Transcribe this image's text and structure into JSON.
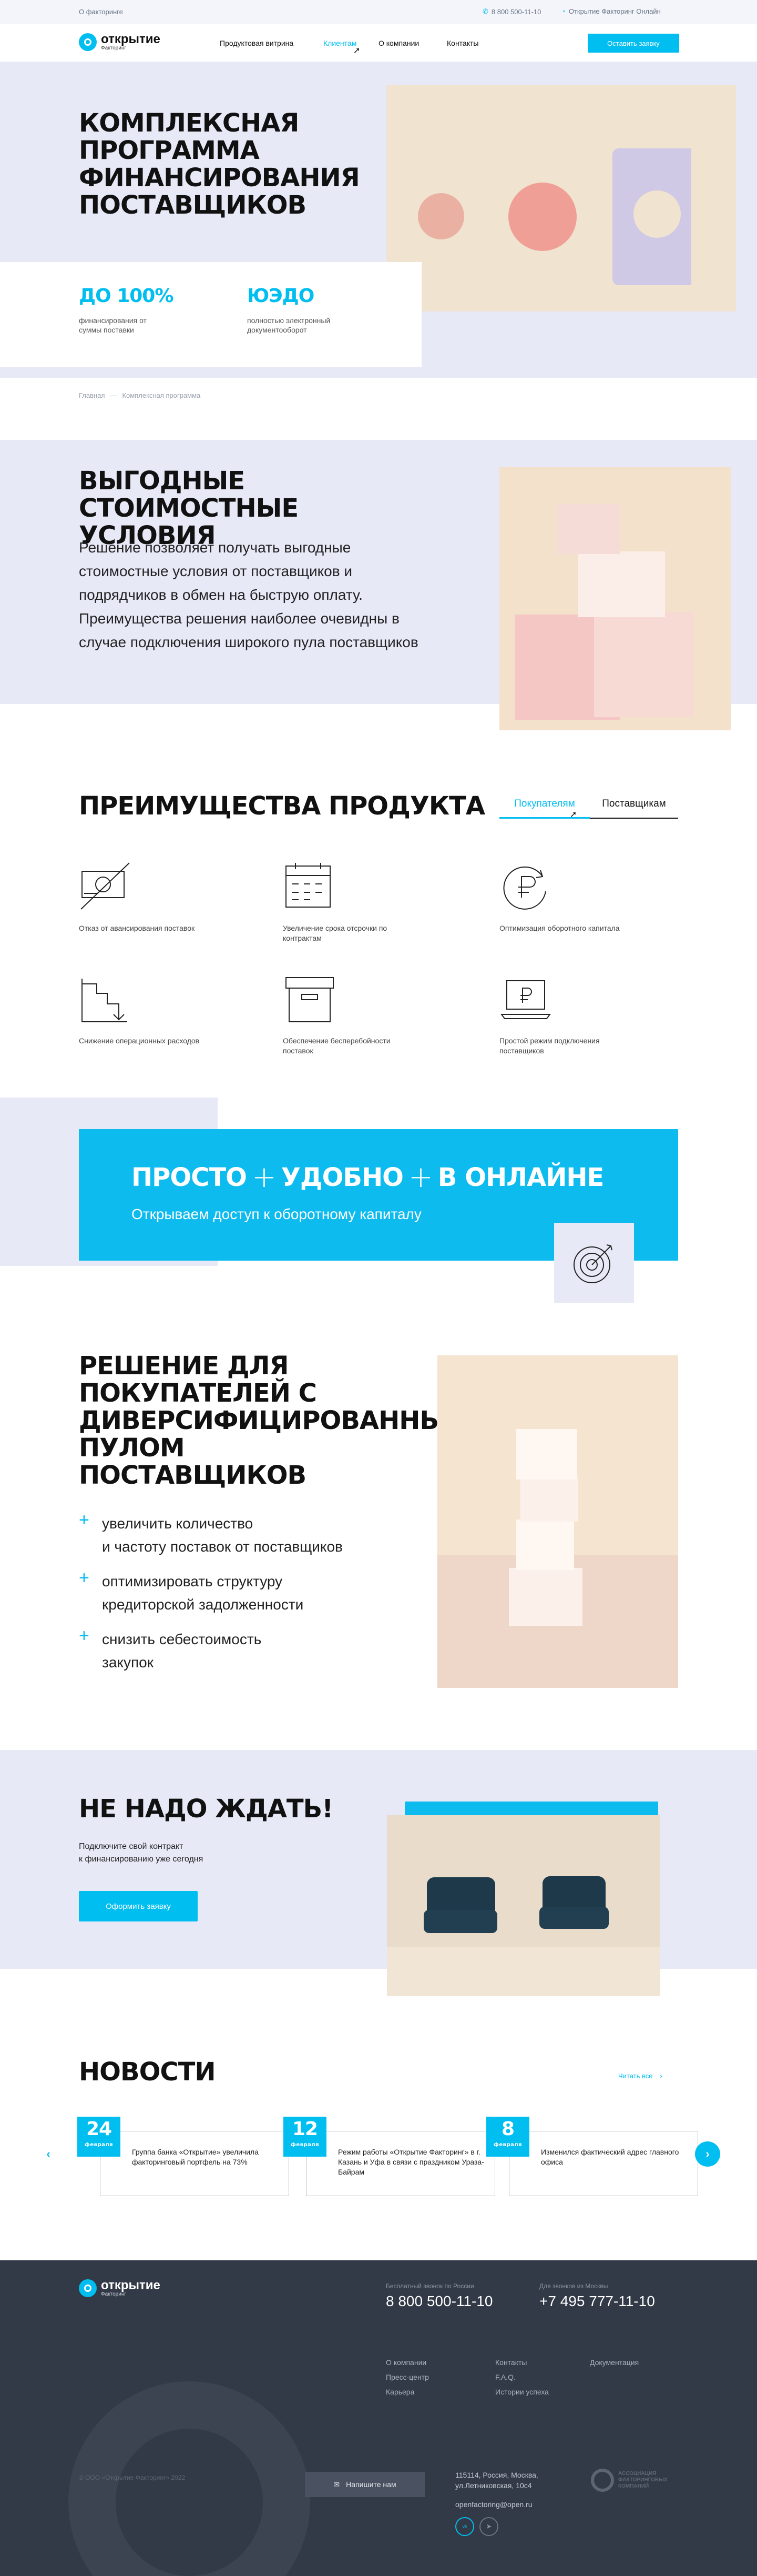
{
  "topbar": {
    "about": "О факторинге",
    "phone": "8 800 500-11-10",
    "online": "Открытие Факторинг Онлайн"
  },
  "brand": {
    "name": "открытие",
    "sub": "Факторинг"
  },
  "nav": {
    "items": [
      "Продуктовая витрина",
      "Клиентам",
      "О компании",
      "Контакты"
    ],
    "cta": "Оставить заявку"
  },
  "hero": {
    "title": "КОМПЛЕКСНАЯ ПРОГРАММА ФИНАНСИРОВАНИЯ ПОСТАВЩИКОВ",
    "stat1": {
      "value": "ДО 100%",
      "text": "финансирования от суммы поставки"
    },
    "stat2": {
      "value": "ЮЭДО",
      "text": "полностью электронный документооборот"
    }
  },
  "breadcrumb": {
    "home": "Главная",
    "sep": "—",
    "current": "Комплексная программа"
  },
  "benefits": {
    "title": "ВЫГОДНЫЕ СТОИМОСТНЫЕ УСЛОВИЯ",
    "text": "Решение позволяет получать выгодные стоимостные условия от поставщиков и подрядчиков в обмен на быструю оплату. Преимущества решения наиболее очевидны в случае подключения широкого пула поставщиков"
  },
  "advantages": {
    "title": "ПРЕИМУЩЕСТВА ПРОДУКТА",
    "tabs": [
      "Покупателям",
      "Поставщикам"
    ],
    "items": [
      {
        "icon": "no-prepayment-icon",
        "text": "Отказ от авансирования поставок"
      },
      {
        "icon": "calendar-icon",
        "text": "Увеличение срока отсрочки по контрактам"
      },
      {
        "icon": "ruble-cycle-icon",
        "text": "Оптимизация оборотного капитала"
      },
      {
        "icon": "chart-down-icon",
        "text": "Снижение операционных расходов"
      },
      {
        "icon": "box-icon",
        "text": "Обеспечение бесперебойности поставок"
      },
      {
        "icon": "laptop-ruble-icon",
        "text": "Простой режим подключения поставщиков"
      }
    ]
  },
  "promo": {
    "w1": "ПРОСТО",
    "w2": "УДОБНО",
    "w3": "В ОНЛАЙНЕ",
    "sub": "Открываем доступ к оборотному капиталу"
  },
  "solution": {
    "title": "РЕШЕНИЕ ДЛЯ ПОКУПАТЕЛЕЙ С ДИВЕРСИФИЦИРОВАННЫМ ПУЛОМ ПОСТАВЩИКОВ",
    "list": [
      {
        "l1": "увеличить количество",
        "l2": "и частоту поставок от поставщиков"
      },
      {
        "l1": "оптимизировать структуру",
        "l2": "кредиторской задолженности"
      },
      {
        "l1": "снизить себестоимость",
        "l2": "закупок"
      }
    ]
  },
  "nowait": {
    "title": "НЕ НАДО ЖДАТЬ!",
    "text1": "Подключите свой контракт",
    "text2": "к финансированию уже сегодня",
    "button": "Оформить заявку"
  },
  "news": {
    "title": "НОВОСТИ",
    "all": "Читать все",
    "items": [
      {
        "day": "24",
        "month": "февраля",
        "text": "Группа банка «Открытие» увеличила факторинговый портфель на 73%"
      },
      {
        "day": "12",
        "month": "февраля",
        "text": "Режим работы «Открытие Факторинг» в г. Казань и Уфа в связи с праздником Ураза-Байрам"
      },
      {
        "day": "8",
        "month": "февраля",
        "text": "Изменился фактический адрес главного офиса"
      }
    ]
  },
  "footer": {
    "phone_label_1": "Бесплатный звонок по России",
    "phone_1": "8 800 500-11-10",
    "phone_label_2": "Для звонков из Москвы",
    "phone_2": "+7 495 777-11-10",
    "col1": [
      "О компании",
      "Пресс-центр",
      "Карьера"
    ],
    "col2": [
      "Контакты",
      "F.A.Q.",
      "Истории успеха"
    ],
    "col3": [
      "Документация"
    ],
    "copyright": "© ООО «Открытие Факторинг» 2022",
    "write": "Напишите нам",
    "address": "115114, Россия, Москва, ул.Летниковская, 10с4",
    "email": "openfactoring@open.ru",
    "assoc": "АССОЦИАЦИЯ ФАКТОРИНГОВЫХ КОМПАНИЙ"
  },
  "colors": {
    "accent": "#00bef0",
    "lavender": "#e7e9f7",
    "footer": "#333a47"
  }
}
